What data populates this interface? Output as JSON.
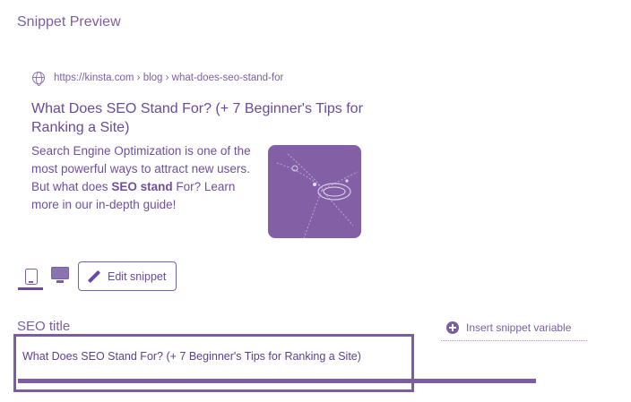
{
  "section_title": "Snippet Preview",
  "preview": {
    "url": "https://kinsta.com › blog › what-does-seo-stand-for",
    "title": "What Does SEO Stand For? (+ 7 Beginner's Tips for Ranking a Site)",
    "description_parts": {
      "before": "Search Engine Optimization is one of the most powerful ways to attract new users. But what does ",
      "bold": "SEO stand",
      "after": " For? Learn more in our in-depth guide!"
    }
  },
  "toolbar": {
    "edit_snippet_label": "Edit snippet"
  },
  "seo_title": {
    "label": "SEO title",
    "insert_variable_label": "Insert snippet variable",
    "value": "What Does SEO Stand For? (+ 7 Beginner's Tips for Ranking a Site)"
  },
  "icons": {
    "globe": "globe-icon",
    "mobile": "mobile-icon",
    "desktop": "desktop-icon",
    "pencil": "pencil-icon",
    "plus": "plus-circle-icon"
  },
  "colors": {
    "accent": "#7a5fa3",
    "title": "#6a4a9c",
    "thumb": "#8360a6"
  }
}
